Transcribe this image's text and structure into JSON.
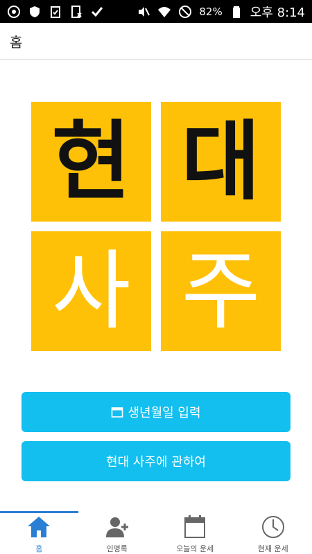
{
  "status_bar": {
    "battery": "82%",
    "time": "오후 8:14",
    "icons_left": [
      "chrome-icon",
      "shield-icon",
      "clipboard-check-icon",
      "sim-icon",
      "checkmark-icon"
    ],
    "icons_right": [
      "mute-icon",
      "wifi-icon",
      "do-not-disturb-icon",
      "battery-icon"
    ]
  },
  "app_bar": {
    "title": "홈"
  },
  "logo": {
    "tiles": [
      "현",
      "대",
      "사",
      "주"
    ],
    "tile_color": "#FFC107"
  },
  "buttons": {
    "birth_input": "생년월일 입력",
    "about": "현대 사주에 관하여",
    "color": "#12BFEF"
  },
  "bottom_nav": {
    "items": [
      {
        "label": "홈",
        "icon": "home-icon",
        "active": true
      },
      {
        "label": "인명록",
        "icon": "add-person-icon",
        "active": false
      },
      {
        "label": "오늘의 운세",
        "icon": "calendar-icon",
        "active": false
      },
      {
        "label": "현재 운세",
        "icon": "clock-icon",
        "active": false
      }
    ],
    "active_color": "#2a7fd4"
  }
}
